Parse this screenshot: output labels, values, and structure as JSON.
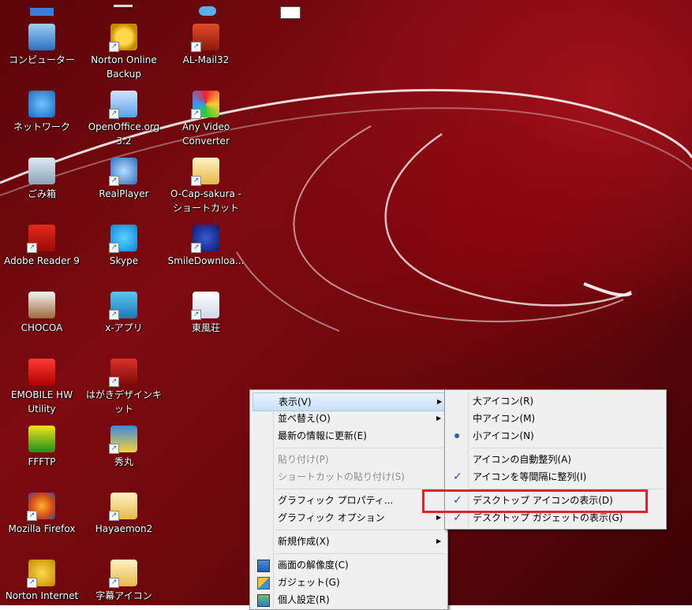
{
  "desktop": {
    "icons": [
      {
        "label": "コンピューター",
        "icon": "computer-icon",
        "shortcut": false
      },
      {
        "label": "Norton Online Backup",
        "icon": "norton-backup-icon",
        "shortcut": true
      },
      {
        "label": "AL-Mail32",
        "icon": "mail-app-icon",
        "shortcut": true
      },
      {
        "label": "ネットワーク",
        "icon": "network-icon",
        "shortcut": false
      },
      {
        "label": "OpenOffice.org 3.2",
        "icon": "openoffice-icon",
        "shortcut": true
      },
      {
        "label": "Any Video Converter",
        "icon": "video-converter-icon",
        "shortcut": true
      },
      {
        "label": "ごみ箱",
        "icon": "recycle-bin-icon",
        "shortcut": false
      },
      {
        "label": "RealPlayer",
        "icon": "realplayer-icon",
        "shortcut": true
      },
      {
        "label": "O-Cap-sakura - ショートカット",
        "icon": "folder-icon",
        "shortcut": true
      },
      {
        "label": "Adobe Reader 9",
        "icon": "adobe-reader-icon",
        "shortcut": true
      },
      {
        "label": "Skype",
        "icon": "skype-icon",
        "shortcut": true
      },
      {
        "label": "SmileDownloa...",
        "icon": "smiledownloader-icon",
        "shortcut": true
      },
      {
        "label": "CHOCOA",
        "icon": "chocoa-icon",
        "shortcut": false
      },
      {
        "label": "x-アプリ",
        "icon": "x-app-icon",
        "shortcut": true
      },
      {
        "label": "東風荘",
        "icon": "mahjong-icon",
        "shortcut": true
      },
      {
        "label": "EMOBILE HW Utility",
        "icon": "emobile-icon",
        "shortcut": false
      },
      {
        "label": "はがきデザインキット",
        "icon": "hagaki-icon",
        "shortcut": true
      },
      {
        "label": "FFFTP",
        "icon": "ffftp-icon",
        "shortcut": false
      },
      {
        "label": "秀丸",
        "icon": "hidemaru-icon",
        "shortcut": true
      },
      {
        "label": "Mozilla Firefox",
        "icon": "firefox-icon",
        "shortcut": true
      },
      {
        "label": "Hayaemon2",
        "icon": "folder-icon",
        "shortcut": true
      },
      {
        "label": "Norton Internet",
        "icon": "norton-internet-icon",
        "shortcut": true
      },
      {
        "label": "字幕アイコン",
        "icon": "folder-icon",
        "shortcut": true
      }
    ]
  },
  "context_menu": {
    "items": [
      {
        "label": "表示(V)",
        "submenu": true,
        "disabled": false,
        "highlighted": true
      },
      {
        "label": "並べ替え(O)",
        "submenu": true,
        "disabled": false
      },
      {
        "label": "最新の情報に更新(E)",
        "submenu": false,
        "disabled": false
      },
      {
        "label": "貼り付け(P)",
        "submenu": false,
        "disabled": true
      },
      {
        "label": "ショートカットの貼り付け(S)",
        "submenu": false,
        "disabled": true
      },
      {
        "label": "グラフィック プロパティ...",
        "submenu": false,
        "disabled": false
      },
      {
        "label": "グラフィック オプション",
        "submenu": true,
        "disabled": false
      },
      {
        "label": "新規作成(X)",
        "submenu": true,
        "disabled": false
      },
      {
        "label": "画面の解像度(C)",
        "icon": "display-icon"
      },
      {
        "label": "ガジェット(G)",
        "icon": "gadget-icon"
      },
      {
        "label": "個人設定(R)",
        "icon": "personalize-icon"
      }
    ]
  },
  "view_submenu": {
    "items": [
      {
        "label": "大アイコン(R)",
        "state": "none"
      },
      {
        "label": "中アイコン(M)",
        "state": "none"
      },
      {
        "label": "小アイコン(N)",
        "state": "radio"
      },
      {
        "label": "アイコンの自動整列(A)",
        "state": "none"
      },
      {
        "label": "アイコンを等間隔に整列(I)",
        "state": "check"
      },
      {
        "label": "デスクトップ アイコンの表示(D)",
        "state": "check",
        "annotated": true
      },
      {
        "label": "デスクトップ ガジェットの表示(G)",
        "state": "check"
      }
    ]
  },
  "colors": {
    "annotation": "#e0242c",
    "wallpaper": "#7d0a10",
    "menu_bg": "#f0f0f0"
  }
}
